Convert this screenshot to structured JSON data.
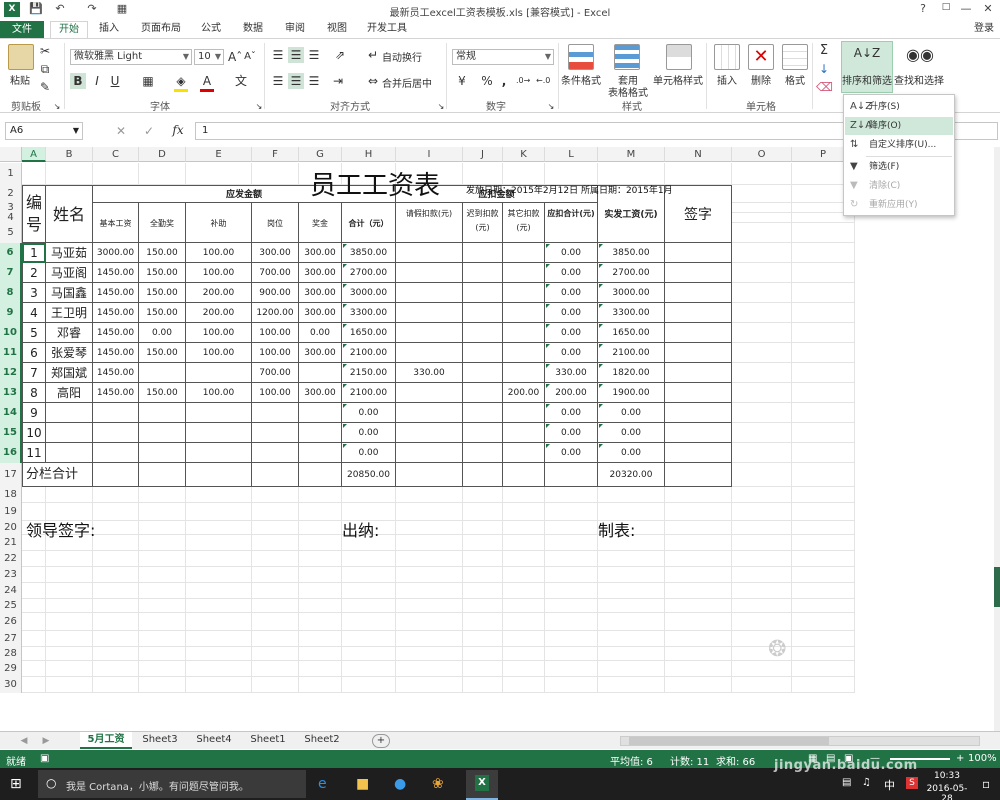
{
  "window": {
    "title": "最新员工excel工资表模板.xls  [兼容模式] - Excel",
    "help": "?",
    "controls": [
      "—",
      "□",
      "✕"
    ],
    "signin": "登录"
  },
  "tabs": [
    "文件",
    "开始",
    "插入",
    "页面布局",
    "公式",
    "数据",
    "审阅",
    "视图",
    "开发工具"
  ],
  "ribbon": {
    "paste": "粘贴",
    "clipboard": "剪贴板",
    "font_name": "微软雅黑 Light",
    "font_size": "10",
    "font_group": "字体",
    "bold": "B",
    "italic": "I",
    "underline": "U",
    "wrap": "自动换行",
    "merge": "合并后居中",
    "align_group": "对齐方式",
    "number_format": "常规",
    "number_group": "数字",
    "percent": "%",
    "comma": ",",
    "cond_format": "条件格式",
    "table_format_1": "套用",
    "table_format_2": "表格格式",
    "cell_style": "单元格样式",
    "style_group": "样式",
    "insert": "插入",
    "delete": "删除",
    "format": "格式",
    "cells_group": "单元格",
    "sort_filter": "排序和筛选",
    "find_select": "查找和选择"
  },
  "sort_menu": [
    {
      "label": "升序(S)",
      "icon": "A↓Z",
      "state": "normal"
    },
    {
      "label": "降序(O)",
      "icon": "Z↓A",
      "state": "hover"
    },
    {
      "label": "自定义排序(U)...",
      "icon": "⇅",
      "state": "normal"
    },
    {
      "label": "筛选(F)",
      "icon": "▼",
      "state": "normal"
    },
    {
      "label": "清除(C)",
      "icon": "▼",
      "state": "disabled"
    },
    {
      "label": "重新应用(Y)",
      "icon": "↻",
      "state": "disabled"
    }
  ],
  "formula_bar": {
    "name_box": "A6",
    "fx": "fx",
    "value": "1"
  },
  "columns": [
    "A",
    "B",
    "C",
    "D",
    "E",
    "F",
    "G",
    "H",
    "I",
    "J",
    "K",
    "L",
    "M",
    "N",
    "O",
    "P"
  ],
  "row_numbers": [
    "1",
    "2",
    "3",
    "4",
    "5",
    "6",
    "7",
    "8",
    "9",
    "10",
    "11",
    "12",
    "13",
    "14",
    "15",
    "16",
    "17",
    "18",
    "19",
    "20",
    "21",
    "22",
    "23",
    "24",
    "25",
    "26",
    "27",
    "28",
    "29",
    "30"
  ],
  "sheet": {
    "title": "员工工资表",
    "issue_date": "发放日期：2015年2月12日 所属日期：2015年1月",
    "h_no": "编号",
    "h_name": "姓名",
    "h_payable": "应发金额",
    "h_deduct": "应扣金额",
    "h_net": "实发工资(元)",
    "h_sign": "签字",
    "sub_headers": [
      "基本工资",
      "全勤奖",
      "补助",
      "岗位",
      "奖金",
      "合计（元）",
      "请假扣款(元)",
      "迟到扣款(元)",
      "其它扣款(元)",
      "应扣合计(元)"
    ],
    "rows": [
      [
        "1",
        "马亚茹",
        "3000.00",
        "150.00",
        "100.00",
        "300.00",
        "300.00",
        "3850.00",
        "",
        "",
        "",
        "0.00",
        "3850.00"
      ],
      [
        "2",
        "马亚阁",
        "1450.00",
        "150.00",
        "100.00",
        "700.00",
        "300.00",
        "2700.00",
        "",
        "",
        "",
        "0.00",
        "2700.00"
      ],
      [
        "3",
        "马国鑫",
        "1450.00",
        "150.00",
        "200.00",
        "900.00",
        "300.00",
        "3000.00",
        "",
        "",
        "",
        "0.00",
        "3000.00"
      ],
      [
        "4",
        "王卫明",
        "1450.00",
        "150.00",
        "200.00",
        "1200.00",
        "300.00",
        "3300.00",
        "",
        "",
        "",
        "0.00",
        "3300.00"
      ],
      [
        "5",
        "邓睿",
        "1450.00",
        "0.00",
        "100.00",
        "100.00",
        "0.00",
        "1650.00",
        "",
        "",
        "",
        "0.00",
        "1650.00"
      ],
      [
        "6",
        "张爱琴",
        "1450.00",
        "150.00",
        "100.00",
        "100.00",
        "300.00",
        "2100.00",
        "",
        "",
        "",
        "0.00",
        "2100.00"
      ],
      [
        "7",
        "郑国斌",
        "1450.00",
        "",
        "",
        "700.00",
        "",
        "2150.00",
        "330.00",
        "",
        "",
        "330.00",
        "1820.00"
      ],
      [
        "8",
        "高阳",
        "1450.00",
        "150.00",
        "100.00",
        "100.00",
        "300.00",
        "2100.00",
        "",
        "",
        "200.00",
        "200.00",
        "1900.00"
      ],
      [
        "9",
        "",
        "",
        "",
        "",
        "",
        "",
        "0.00",
        "",
        "",
        "",
        "0.00",
        "0.00"
      ],
      [
        "10",
        "",
        "",
        "",
        "",
        "",
        "",
        "0.00",
        "",
        "",
        "",
        "0.00",
        "0.00"
      ],
      [
        "11",
        "",
        "",
        "",
        "",
        "",
        "",
        "0.00",
        "",
        "",
        "",
        "0.00",
        "0.00"
      ]
    ],
    "subtotal_label": "分栏合计",
    "subtotal_total": "20850.00",
    "subtotal_net": "20320.00",
    "leader_sign": "领导签字:",
    "cashier": "出纳:",
    "preparer": "制表:"
  },
  "sheet_tabs": [
    "5月工资",
    "Sheet3",
    "Sheet4",
    "Sheet1",
    "Sheet2"
  ],
  "add_sheet": "+",
  "status": {
    "ready": "就绪",
    "average": "平均值: 6",
    "count": "计数: 11",
    "sum": "求和: 66",
    "zoom": "100%"
  },
  "taskbar": {
    "search": "我是 Cortana，小娜。有问题尽管问我。",
    "time": "10:33",
    "date": "2016-05-28",
    "ime": "中"
  },
  "watermark": "jingyan.baidu.com"
}
